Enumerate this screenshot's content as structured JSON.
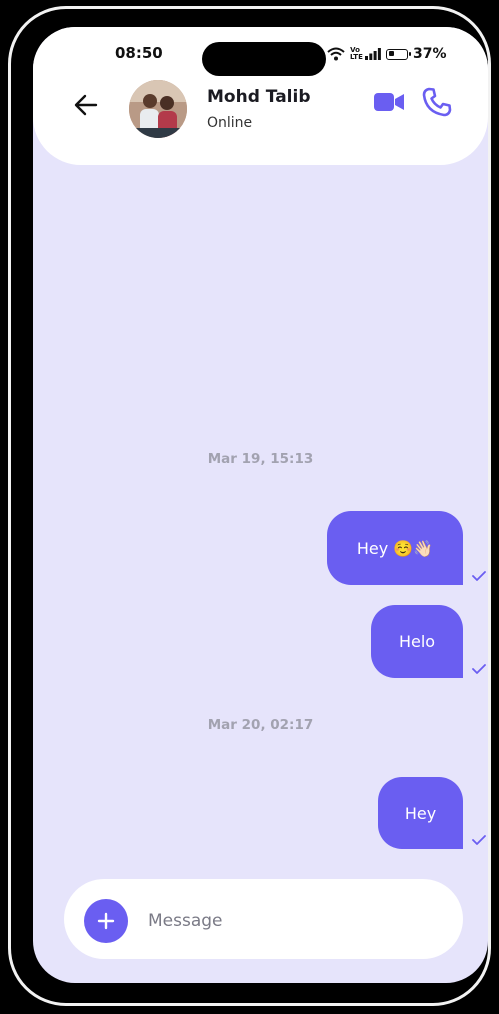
{
  "status_bar": {
    "time": "08:50",
    "network": "Vo LTE",
    "battery": "37%",
    "battery_level": 0.37
  },
  "header": {
    "contact_name": "Mohd Talib",
    "contact_status": "Online",
    "back_icon": "arrow-left-icon",
    "video_icon": "video-camera-icon",
    "call_icon": "phone-icon"
  },
  "messages": [
    {
      "type": "date",
      "text": "Mar 19, 15:13"
    },
    {
      "type": "outgoing",
      "text": "Hey ☺️👋🏻",
      "status": "sent"
    },
    {
      "type": "outgoing",
      "text": "Helo",
      "status": "sent"
    },
    {
      "type": "date",
      "text": "Mar 20, 02:17"
    },
    {
      "type": "outgoing",
      "text": "Hey",
      "status": "sent"
    }
  ],
  "composer": {
    "placeholder": "Message",
    "add_icon": "plus-icon"
  },
  "colors": {
    "accent": "#6a5ef1",
    "chat_background": "#e6e4fb",
    "date_text": "#a2a2b0"
  }
}
